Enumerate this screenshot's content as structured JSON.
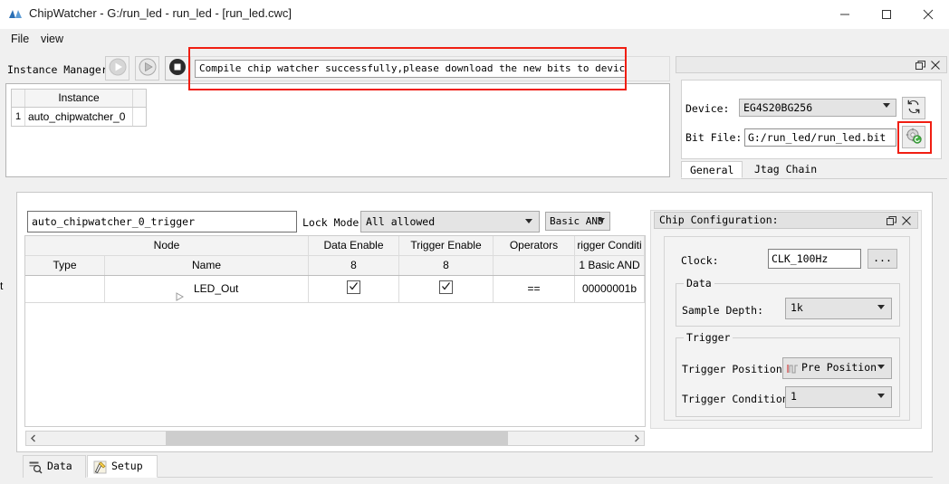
{
  "window": {
    "title": "ChipWatcher - G:/run_led - run_led - [run_led.cwc]",
    "app_icon": "chipwatcher-logo-icon",
    "minimize_label": "—",
    "maximize_label": "□",
    "close_label": "✕"
  },
  "menu": {
    "file": "File",
    "view": "view"
  },
  "instance_manager": {
    "label": "Instance Manager:",
    "buttons": [
      {
        "name": "run-button",
        "icon": "play-circle-icon",
        "enabled": false
      },
      {
        "name": "run-step-button",
        "icon": "play-circle-icon",
        "enabled": false
      },
      {
        "name": "stop-button",
        "icon": "stop-circle-icon",
        "enabled": true
      }
    ],
    "message": "Compile chip watcher successfully,please download the new bits to device.",
    "message_highlight_color": "#f01e12"
  },
  "instance_table": {
    "header": "Instance",
    "rows": [
      {
        "num": "1",
        "instance": "auto_chipwatcher_0"
      }
    ]
  },
  "device_panel": {
    "float_icon": "restore-icon",
    "close_icon": "close-icon",
    "device_label": "Device:",
    "device_value": "EG4S20BG256",
    "bitfile_label": "Bit File:",
    "bitfile_value": "G:/run_led/run_led.bit",
    "refresh_icon": "refresh-icon",
    "download_icon": "download-bitstream-icon",
    "download_highlight_color": "#f01e12",
    "tabs": [
      {
        "label": "General",
        "active": true
      },
      {
        "label": "Jtag Chain",
        "active": false
      }
    ]
  },
  "trigger_setup": {
    "name_value": "auto_chipwatcher_0_trigger",
    "lock_mode_label": "Lock Mode:",
    "lock_mode_value": "All allowed",
    "basic_value": "Basic AND",
    "columns_top": [
      "Node",
      "Data Enable",
      "Trigger Enable",
      "Operators",
      "rigger Conditi"
    ],
    "columns_sub": [
      "Type",
      "Name",
      "8",
      "8",
      "",
      "1 Basic AND"
    ],
    "rows": [
      {
        "type": "t",
        "expander": "triangle-right-icon",
        "name": "LED_Out",
        "data_enable": true,
        "trigger_enable": true,
        "operator": "==",
        "condition": "00000001b"
      }
    ],
    "scroll_left_icon": "chevron-left-icon",
    "scroll_right_icon": "chevron-right-icon"
  },
  "chip_configuration": {
    "title": "Chip Configuration:",
    "float_icon": "restore-icon",
    "close_icon": "close-icon",
    "clock_label": "Clock:",
    "clock_value": "CLK_100Hz",
    "browse_label": "...",
    "data_group": "Data",
    "sample_depth_label": "Sample Depth:",
    "sample_depth_value": "1k",
    "trigger_group": "Trigger",
    "trigger_position_label": "Trigger Position:",
    "trigger_position_value": "Pre Position",
    "trigger_position_icon": "waveform-icon",
    "trigger_conditions_label": "Trigger Conditions",
    "trigger_conditions_value": "1"
  },
  "bottom_tabs": [
    {
      "label": "Data",
      "icon": "data-grid-icon",
      "active": false
    },
    {
      "label": "Setup",
      "icon": "setup-tools-icon",
      "active": true
    }
  ]
}
